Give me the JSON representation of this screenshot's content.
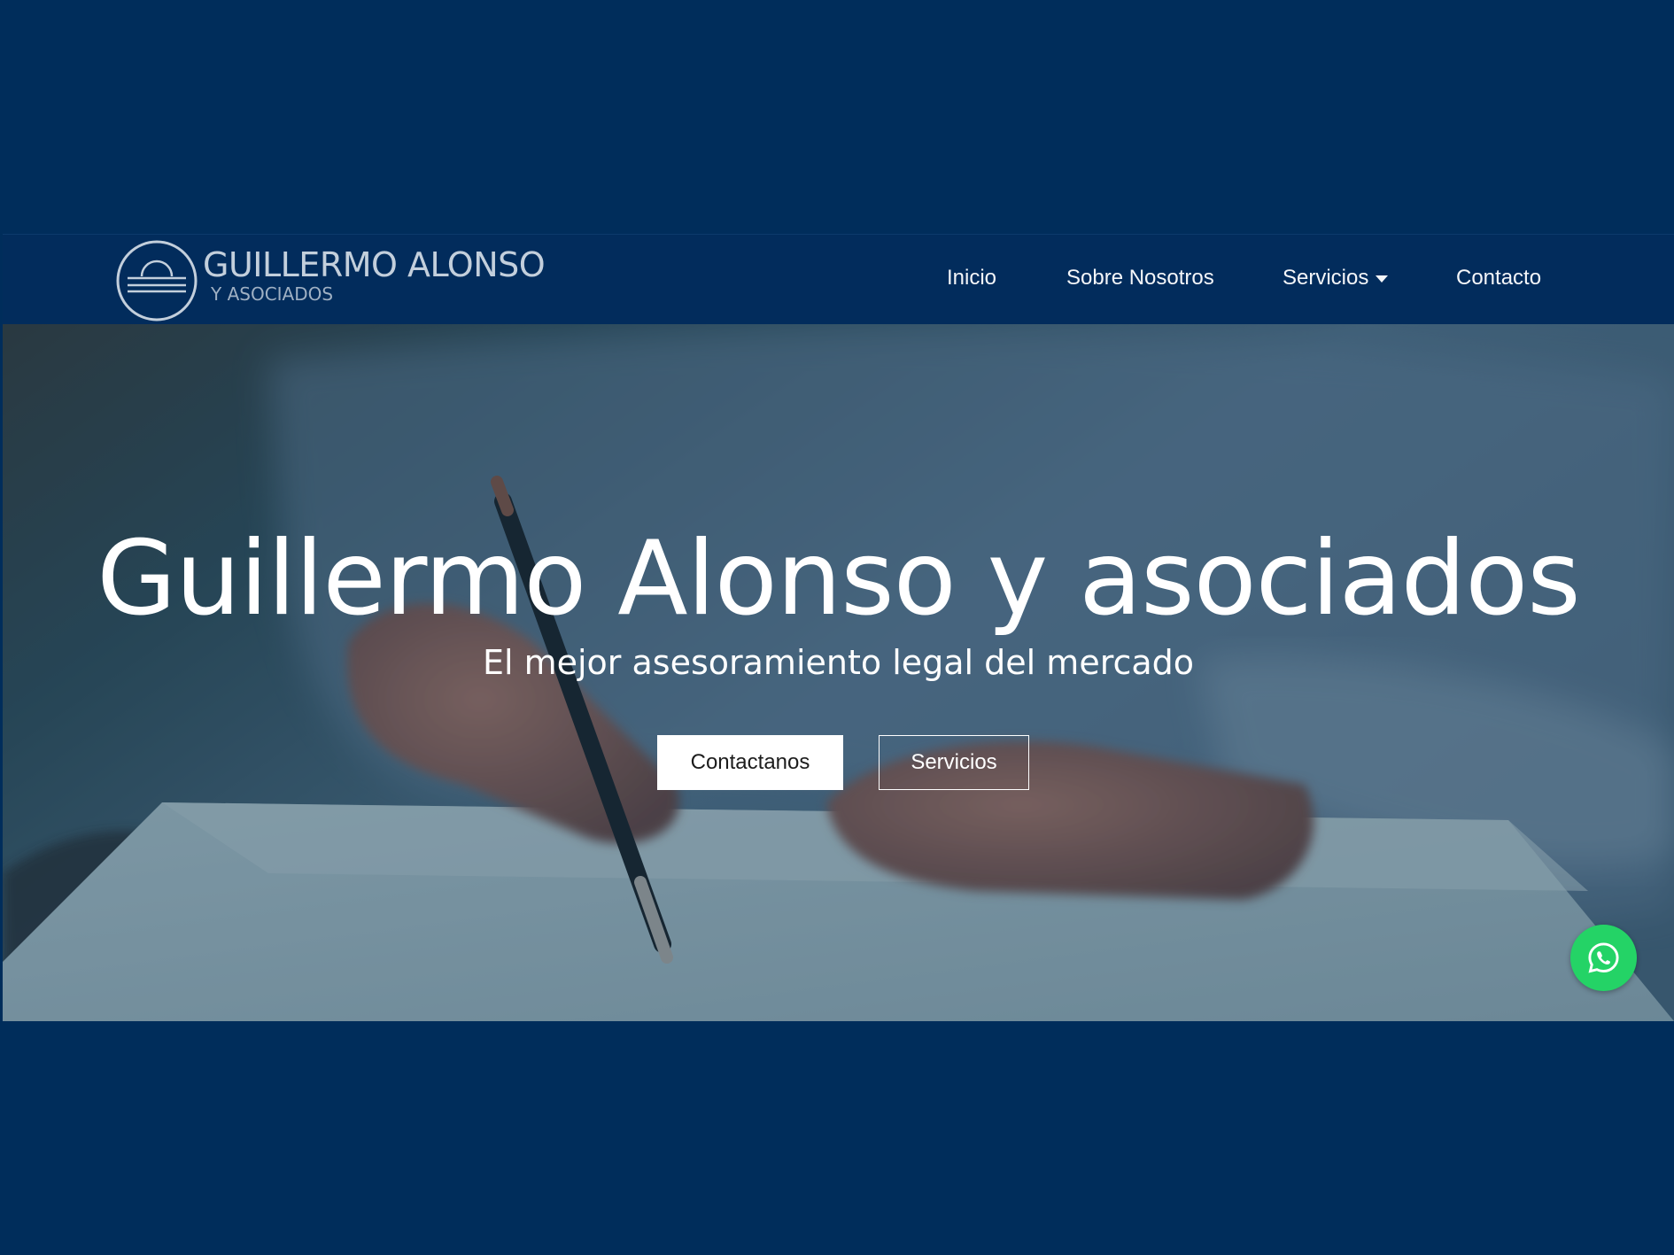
{
  "brand": {
    "logo_title": "GUILLERMO ALONSO",
    "logo_subtitle": "Y ASOCIADOS"
  },
  "nav": {
    "items": [
      {
        "label": "Inicio"
      },
      {
        "label": "Sobre Nosotros"
      },
      {
        "label": "Servicios",
        "has_dropdown": true
      },
      {
        "label": "Contacto"
      }
    ]
  },
  "hero": {
    "title": "Guillermo Alonso y asociados",
    "subtitle": "El mejor asesoramiento legal del mercado",
    "primary_button": "Contactanos",
    "secondary_button": "Servicios"
  },
  "icons": {
    "logo": "scales-emblem-icon",
    "dropdown": "caret-down-icon",
    "floating": "whatsapp-icon"
  },
  "colors": {
    "page_background": "#002d5b",
    "navbar": "#022c5c",
    "whatsapp": "#24d366",
    "text": "#ffffff"
  }
}
